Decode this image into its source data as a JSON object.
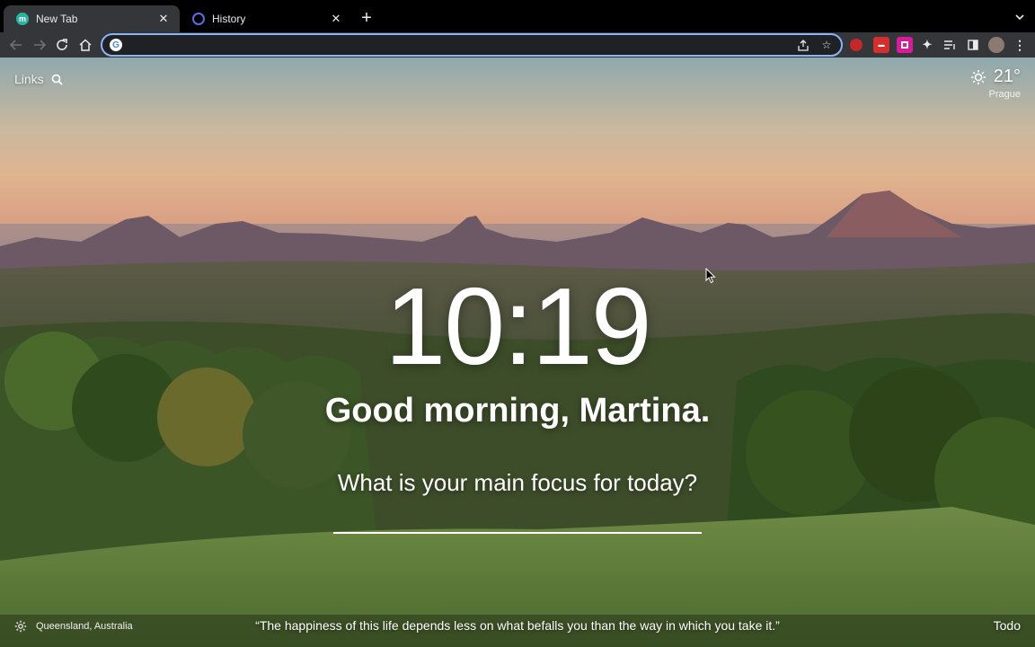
{
  "browser": {
    "tabs": [
      {
        "title": "New Tab",
        "favicon_icon": "momentum-icon",
        "active": true
      },
      {
        "title": "History",
        "favicon_icon": "history-icon",
        "active": false
      }
    ],
    "omnibox": {
      "value": "",
      "placeholder": ""
    },
    "colors": {
      "tabstrip": "#000000",
      "toolbar": "#35363a",
      "omnibox_focus": "#8ab4f8"
    }
  },
  "momentum": {
    "links_label": "Links",
    "weather": {
      "temperature": "21°",
      "location": "Prague",
      "icon": "sun-icon"
    },
    "clock": "10:19",
    "greeting": "Good morning, Martina.",
    "focus_question": "What is your main focus for today?",
    "focus_value": "",
    "photo_location": "Queensland, Australia",
    "quote": "“The happiness of this life depends less on what befalls you than the way in which you take it.”",
    "todo_label": "Todo"
  }
}
